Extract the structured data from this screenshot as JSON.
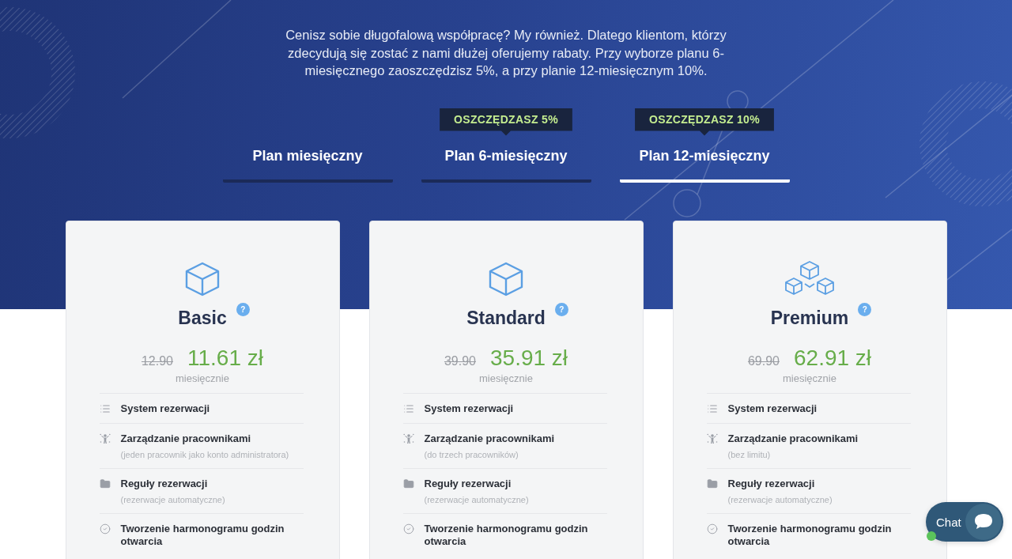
{
  "intro": "Cenisz sobie długofalową współpracę? My również. Dlatego klientom, którzy zdecydują się zostać z nami dłużej oferujemy rabaty. Przy wyborze planu 6-miesięcznego zaoszczędzisz 5%, a przy planie 12-miesięcznym 10%.",
  "tabs": [
    {
      "label": "Plan miesięczny",
      "selected": false
    },
    {
      "label": "Plan 6-miesięczny",
      "selected": false,
      "badge": "OSZCZĘDZASZ 5%"
    },
    {
      "label": "Plan 12-miesięczny",
      "selected": true,
      "badge": "OSZCZĘDZASZ 10%"
    }
  ],
  "plans": [
    {
      "name": "Basic",
      "help": "?",
      "old_price": "12.90",
      "price": "11.61 zł",
      "period": "miesięcznie",
      "features": [
        {
          "title": "System rezerwacji"
        },
        {
          "title": "Zarządzanie pracownikami",
          "note": "(jeden pracownik jako konto administratora)"
        },
        {
          "title": "Reguły rezerwacji",
          "note": "(rezerwacje automatyczne)"
        },
        {
          "title": "Tworzenie harmonogramu godzin otwarcia"
        }
      ]
    },
    {
      "name": "Standard",
      "help": "?",
      "old_price": "39.90",
      "price": "35.91 zł",
      "period": "miesięcznie",
      "features": [
        {
          "title": "System rezerwacji"
        },
        {
          "title": "Zarządzanie pracownikami",
          "note": "(do trzech pracowników)"
        },
        {
          "title": "Reguły rezerwacji",
          "note": "(rezerwacje automatyczne)"
        },
        {
          "title": "Tworzenie harmonogramu godzin otwarcia"
        }
      ]
    },
    {
      "name": "Premium",
      "help": "?",
      "old_price": "69.90",
      "price": "62.91 zł",
      "period": "miesięcznie",
      "features": [
        {
          "title": "System rezerwacji"
        },
        {
          "title": "Zarządzanie pracownikami",
          "note": "(bez limitu)"
        },
        {
          "title": "Reguły rezerwacji",
          "note": "(rezerwacje automatyczne)"
        },
        {
          "title": "Tworzenie harmonogramu godzin otwarcia"
        }
      ]
    }
  ],
  "chat": {
    "label": "Chat",
    "online": true
  }
}
